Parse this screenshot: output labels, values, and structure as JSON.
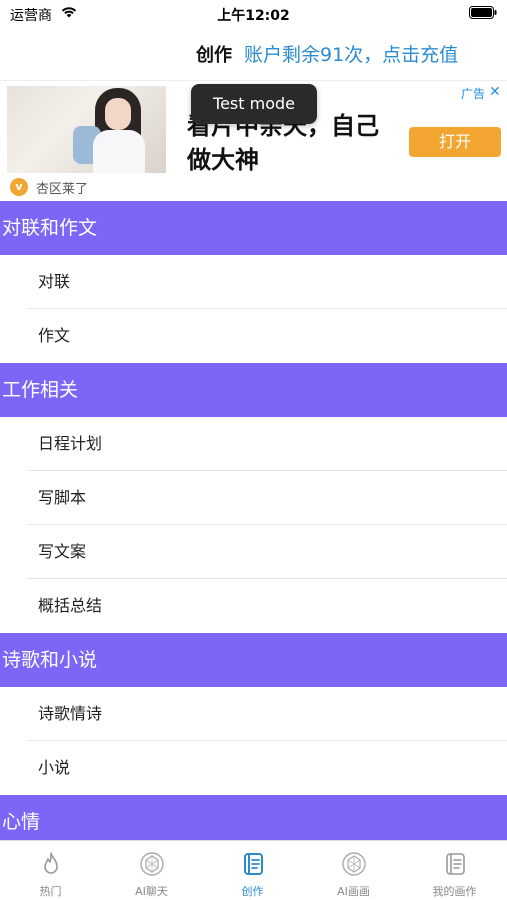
{
  "status_bar": {
    "carrier": "运营商",
    "time": "上午12:02"
  },
  "nav": {
    "title": "创作",
    "recharge": "账户剩余91次，点击充值"
  },
  "ad": {
    "headline": "看片中亲天，自己做大神",
    "open_label": "打开",
    "tag": "广告",
    "close": "✕",
    "source_badge": "v",
    "source": "杏区莱了"
  },
  "toast": "Test mode",
  "sections": [
    {
      "title": "对联和作文",
      "items": [
        "对联",
        "作文"
      ]
    },
    {
      "title": "工作相关",
      "items": [
        "日程计划",
        "写脚本",
        "写文案",
        "概括总结"
      ]
    },
    {
      "title": "诗歌和小说",
      "items": [
        "诗歌情诗",
        "小说"
      ]
    },
    {
      "title": "心情",
      "items": []
    }
  ],
  "tabs": [
    {
      "label": "热门",
      "icon": "flame-icon"
    },
    {
      "label": "AI聊天",
      "icon": "ai-chat-icon"
    },
    {
      "label": "创作",
      "icon": "notebook-icon",
      "active": true
    },
    {
      "label": "AI画画",
      "icon": "ai-paint-icon"
    },
    {
      "label": "我的画作",
      "icon": "gallery-icon"
    }
  ],
  "colors": {
    "section_header": "#7b66f7",
    "accent_blue": "#2a8ccf",
    "ad_button": "#f3a531"
  }
}
